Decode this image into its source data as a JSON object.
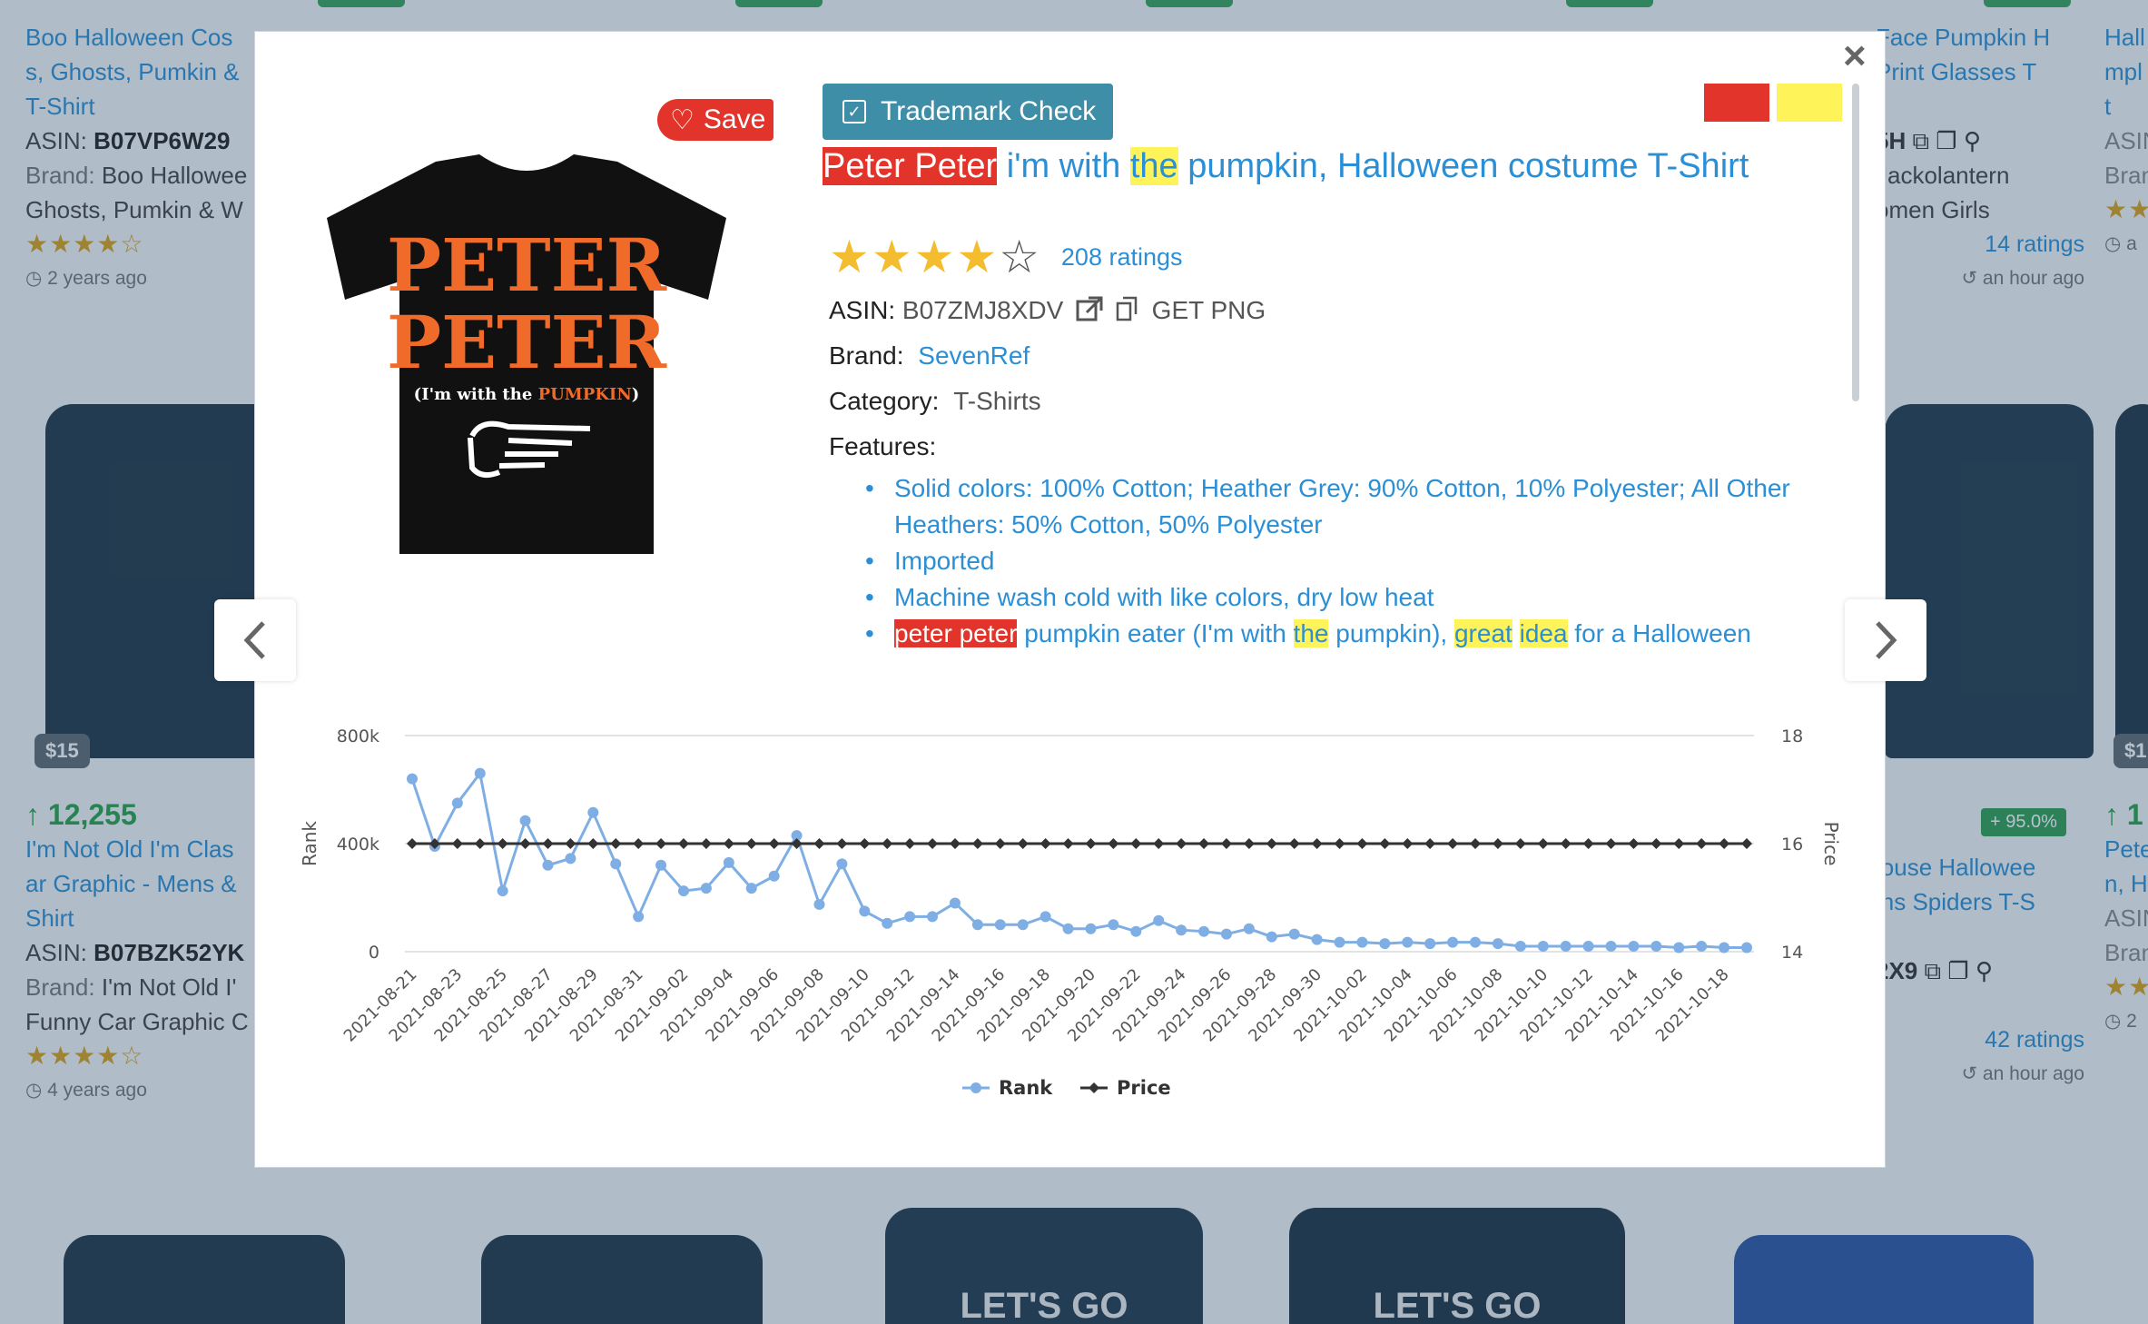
{
  "background": {
    "cards": [
      {
        "title": "Boo Halloween Costumes, Ghosts, Pumkin & T-Shirt",
        "title_lines": [
          "Boo Halloween Cos",
          "s, Ghosts, Pumkin &",
          "T-Shirt"
        ],
        "asin_label": "ASIN:",
        "asin": "B07VP6W29",
        "brand_label": "Brand:",
        "brand": "Boo Hallowee",
        "brand_line2": "Ghosts, Pumkin & W",
        "stars": "★★★★☆",
        "ago": "2 years ago"
      },
      {
        "price": "$15",
        "rank_change": "12,255",
        "title_lines": [
          "I'm Not Old I'm Clas",
          "ar Graphic - Mens &",
          "Shirt"
        ],
        "asin_label": "ASIN:",
        "asin": "B07BZK52YK",
        "brand_label": "Brand:",
        "brand": "I'm Not Old I'",
        "brand_line2": "Funny Car Graphic C",
        "stars": "★★★★☆",
        "ago": "4 years ago"
      },
      {
        "title_lines": [
          "Face Pumpkin H",
          "Print Glasses T"
        ],
        "asin_suffix": "5H",
        "brand": "Jackolantern",
        "brand_line2": "omen Girls",
        "ratings": "14 ratings",
        "ago": "an hour ago"
      },
      {
        "pct": "+ 95.0%",
        "title_lines": [
          "louse Hallowee",
          "ins Spiders T-S"
        ],
        "asin_suffix": "2X9",
        "ratings": "42 ratings",
        "ago": "an hour ago"
      },
      {
        "title_lines": [
          "Hall",
          "mpl",
          "t"
        ],
        "asin_label": "ASIN",
        "brand_label": "Bran",
        "ago": "a"
      },
      {
        "price": "$1",
        "rank_change": "1",
        "title_lines": [
          "Pete",
          "n, H"
        ],
        "asin_label": "ASIN",
        "brand_label": "Bran",
        "ago": "2"
      }
    ],
    "hoodie_texts": [
      "LET'S GO",
      "LET'S GO"
    ]
  },
  "modal": {
    "close_label": "×",
    "save_label": "Save",
    "trademark_label": "Trademark Check",
    "swatch_colors": [
      "#e2342a",
      "#fff35a"
    ],
    "title": {
      "part1_hl_red": "Peter Peter",
      "part2": " i'm with ",
      "part3_hl_yellow": "the",
      "part4": " pumpkin, Halloween costume T-Shirt"
    },
    "rating_stars": "★★★★",
    "rating_empty": "☆",
    "ratings_count": "208 ratings",
    "asin_label": "ASIN:",
    "asin": "B07ZMJ8XDV",
    "get_png": "GET PNG",
    "brand_label": "Brand:",
    "brand": "SevenRef",
    "category_label": "Category:",
    "category": "T-Shirts",
    "features_label": "Features:",
    "features": [
      "Solid colors: 100% Cotton; Heather Grey: 90% Cotton, 10% Polyester; All Other Heathers: 50% Cotton, 50% Polyester",
      "Imported",
      "Machine wash cold with like colors, dry low heat"
    ],
    "feature4": {
      "a_hl_red": "peter peter",
      "b": " pumpkin eater (I'm with ",
      "c_hl_yellow": "the",
      "d": " pumpkin), ",
      "e_hl_yellow": "great",
      "f": " ",
      "g_hl_yellow": "idea",
      "h": " for a Halloween"
    },
    "shirt_print": {
      "line1": "PETER",
      "line2": "PETER",
      "line3a": "(I'm with the ",
      "line3b": "PUMPKIN",
      "line3c": ")"
    }
  },
  "chart_data": {
    "type": "line",
    "x": [
      "2021-08-21",
      "2021-08-22",
      "2021-08-23",
      "2021-08-24",
      "2021-08-25",
      "2021-08-26",
      "2021-08-27",
      "2021-08-28",
      "2021-08-29",
      "2021-08-30",
      "2021-08-31",
      "2021-09-01",
      "2021-09-02",
      "2021-09-03",
      "2021-09-04",
      "2021-09-05",
      "2021-09-06",
      "2021-09-07",
      "2021-09-08",
      "2021-09-09",
      "2021-09-10",
      "2021-09-11",
      "2021-09-12",
      "2021-09-13",
      "2021-09-14",
      "2021-09-15",
      "2021-09-16",
      "2021-09-17",
      "2021-09-18",
      "2021-09-19",
      "2021-09-20",
      "2021-09-21",
      "2021-09-22",
      "2021-09-23",
      "2021-09-24",
      "2021-09-25",
      "2021-09-26",
      "2021-09-27",
      "2021-09-28",
      "2021-09-29",
      "2021-09-30",
      "2021-10-01",
      "2021-10-02",
      "2021-10-03",
      "2021-10-04",
      "2021-10-05",
      "2021-10-06",
      "2021-10-07",
      "2021-10-08",
      "2021-10-09",
      "2021-10-10",
      "2021-10-11",
      "2021-10-12",
      "2021-10-13",
      "2021-10-14",
      "2021-10-15",
      "2021-10-16",
      "2021-10-17",
      "2021-10-18",
      "2021-10-19"
    ],
    "x_tick_labels": [
      "2021-08-21",
      "2021-08-23",
      "2021-08-25",
      "2021-08-27",
      "2021-08-29",
      "2021-08-31",
      "2021-09-02",
      "2021-09-04",
      "2021-09-06",
      "2021-09-08",
      "2021-09-10",
      "2021-09-12",
      "2021-09-14",
      "2021-09-16",
      "2021-09-18",
      "2021-09-20",
      "2021-09-22",
      "2021-09-24",
      "2021-09-26",
      "2021-09-28",
      "2021-09-30",
      "2021-10-02",
      "2021-10-04",
      "2021-10-06",
      "2021-10-08",
      "2021-10-10",
      "2021-10-12",
      "2021-10-14",
      "2021-10-16",
      "2021-10-18"
    ],
    "series": [
      {
        "name": "Rank",
        "axis": "left",
        "color": "#7eaee3",
        "values": [
          640000,
          390000,
          550000,
          660000,
          225000,
          485000,
          320000,
          345000,
          515000,
          325000,
          130000,
          320000,
          225000,
          235000,
          330000,
          235000,
          280000,
          430000,
          175000,
          325000,
          150000,
          105000,
          130000,
          130000,
          180000,
          100000,
          100000,
          100000,
          130000,
          85000,
          85000,
          100000,
          75000,
          115000,
          80000,
          75000,
          65000,
          85000,
          55000,
          65000,
          45000,
          35000,
          35000,
          30000,
          35000,
          30000,
          35000,
          35000,
          30000,
          20000,
          20000,
          20000,
          20000,
          20000,
          20000,
          20000,
          15000,
          20000,
          15000,
          15000
        ]
      },
      {
        "name": "Price",
        "axis": "right",
        "color": "#333333",
        "values": [
          16,
          16,
          16,
          16,
          16,
          16,
          16,
          16,
          16,
          16,
          16,
          16,
          16,
          16,
          16,
          16,
          16,
          16,
          16,
          16,
          16,
          16,
          16,
          16,
          16,
          16,
          16,
          16,
          16,
          16,
          16,
          16,
          16,
          16,
          16,
          16,
          16,
          16,
          16,
          16,
          16,
          16,
          16,
          16,
          16,
          16,
          16,
          16,
          16,
          16,
          16,
          16,
          16,
          16,
          16,
          16,
          16,
          16,
          16,
          16
        ]
      }
    ],
    "ylabel": "Rank",
    "y2label": "Price",
    "yticks": [
      "800k",
      "400k",
      "0"
    ],
    "ylim": [
      0,
      800000
    ],
    "y2ticks": [
      "18",
      "16",
      "14"
    ],
    "y2lim": [
      14,
      18
    ],
    "legend": [
      "Rank",
      "Price"
    ],
    "legend_position": "bottom",
    "grid": true
  }
}
